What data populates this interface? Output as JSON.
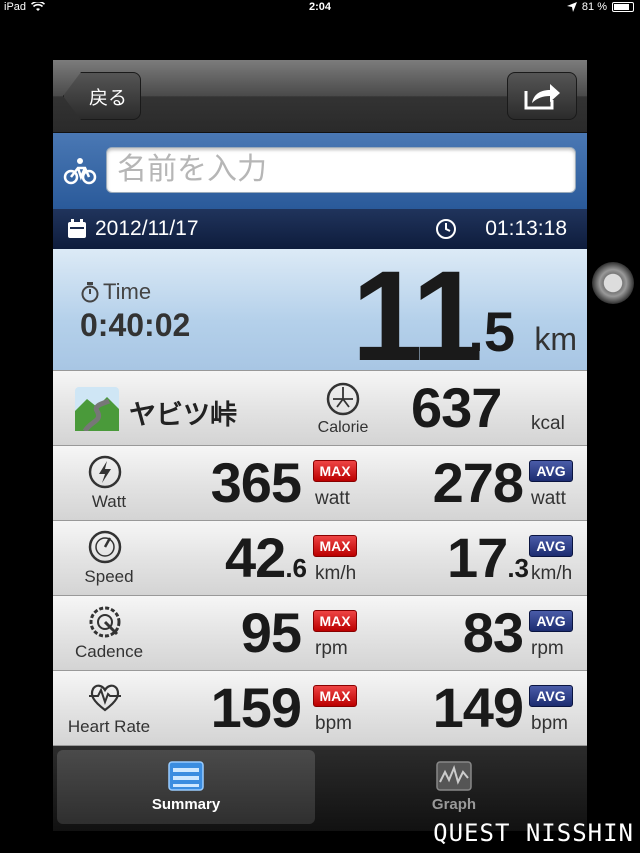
{
  "status_bar": {
    "device": "iPad",
    "time": "2:04",
    "battery": "81 %"
  },
  "nav": {
    "back_label": "戻る"
  },
  "name_input": {
    "placeholder": "名前を入力"
  },
  "session": {
    "date": "2012/11/17",
    "clock": "01:13:18"
  },
  "hero": {
    "time_label": "Time",
    "time_value": "0:40:02",
    "distance_int": "11",
    "distance_dec": ".5",
    "distance_unit": "km"
  },
  "route": {
    "name": "ヤビツ峠",
    "calorie_label": "Calorie",
    "calorie_value": "637",
    "calorie_unit": "kcal"
  },
  "stats": [
    {
      "label": "Watt",
      "max_int": "365",
      "max_dec": "",
      "max_unit": "watt",
      "avg_int": "278",
      "avg_dec": "",
      "avg_unit": "watt"
    },
    {
      "label": "Speed",
      "max_int": "42",
      "max_dec": ".6",
      "max_unit": "km/h",
      "avg_int": "17",
      "avg_dec": ".3",
      "avg_unit": "km/h"
    },
    {
      "label": "Cadence",
      "max_int": "95",
      "max_dec": "",
      "max_unit": "rpm",
      "avg_int": "83",
      "avg_dec": "",
      "avg_unit": "rpm"
    },
    {
      "label": "Heart Rate",
      "max_int": "159",
      "max_dec": "",
      "max_unit": "bpm",
      "avg_int": "149",
      "avg_dec": "",
      "avg_unit": "bpm"
    }
  ],
  "badges": {
    "max": "MAX",
    "avg": "AVG"
  },
  "tabs": [
    {
      "label": "Summary"
    },
    {
      "label": "Graph"
    }
  ],
  "watermark": "QUEST NISSHIN",
  "colors": {
    "max_badge": "#cc1111",
    "avg_badge": "#223580",
    "header_blue": "#2a5a9a"
  }
}
